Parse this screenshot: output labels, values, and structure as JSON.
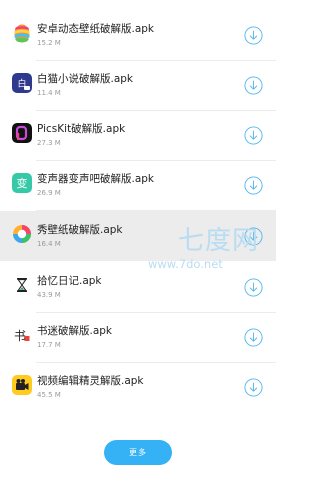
{
  "files": [
    {
      "name": "安卓动态壁纸破解版.apk",
      "size": "15.2 M",
      "icon": "easter-egg-icon"
    },
    {
      "name": "白猫小说破解版.apk",
      "size": "11.4 M",
      "icon": "white-cat-novel-icon"
    },
    {
      "name": "PicsKit破解版.apk",
      "size": "27.3 M",
      "icon": "picskit-icon"
    },
    {
      "name": "变声器变声吧破解版.apk",
      "size": "26.9 M",
      "icon": "voice-changer-icon"
    },
    {
      "name": "秀壁纸破解版.apk",
      "size": "16.4 M",
      "icon": "xiu-wallpaper-icon"
    },
    {
      "name": "拾忆日记.apk",
      "size": "43.9 M",
      "icon": "hourglass-icon"
    },
    {
      "name": "书迷破解版.apk",
      "size": "17.7 M",
      "icon": "shumi-book-icon"
    },
    {
      "name": "视频编辑精灵解版.apk",
      "size": "45.5 M",
      "icon": "video-editor-icon"
    }
  ],
  "more_label": "更多",
  "watermark": {
    "logo": "七度网",
    "url": "www.7do.net"
  },
  "colors": {
    "accent": "#35b1f5",
    "download_icon": "#4fb5ee",
    "highlight_row": "#ececec"
  }
}
